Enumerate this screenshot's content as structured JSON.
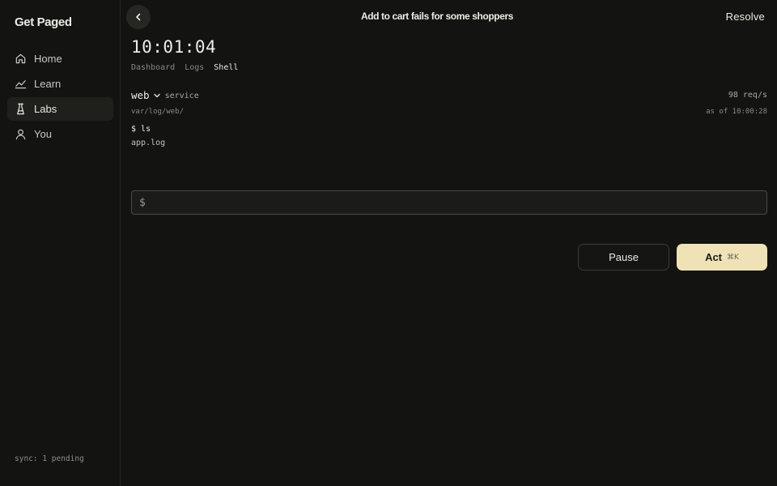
{
  "app": {
    "name": "Get Paged"
  },
  "sidebar": {
    "items": [
      {
        "label": "Home",
        "icon": "home-icon",
        "active": false
      },
      {
        "label": "Learn",
        "icon": "trend-chart-icon",
        "active": false
      },
      {
        "label": "Labs",
        "icon": "flask-icon",
        "active": true
      },
      {
        "label": "You",
        "icon": "user-icon",
        "active": false
      }
    ],
    "sync_status": "sync: 1 pending"
  },
  "header": {
    "incident_title": "Add to cart fails for some shoppers",
    "resolve_label": "Resolve"
  },
  "clock": "10:01:04",
  "tabs": [
    {
      "label": "Dashboard",
      "active": false
    },
    {
      "label": "Logs",
      "active": false
    },
    {
      "label": "Shell",
      "active": true
    }
  ],
  "service": {
    "name": "web",
    "type": "service",
    "rate": "98 req/s",
    "path": "var/log/web/",
    "as_of": "as of 10:00:28"
  },
  "terminal": {
    "command": "$ ls",
    "output": "app.log"
  },
  "shell_input": {
    "prompt": "$",
    "value": "",
    "placeholder": ""
  },
  "actions": {
    "pause_label": "Pause",
    "act_label": "Act",
    "act_shortcut": "⌘K"
  },
  "colors": {
    "background": "#131411",
    "accent": "#efe2b7"
  }
}
